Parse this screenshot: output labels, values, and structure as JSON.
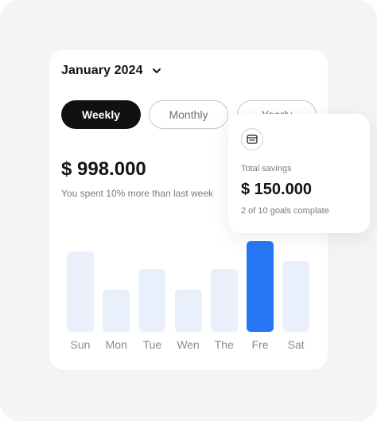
{
  "header": {
    "month_label": "January 2024",
    "dropdown_icon": "chevron-down-icon"
  },
  "tabs": [
    {
      "label": "Weekly",
      "active": true
    },
    {
      "label": "Monthly",
      "active": false
    },
    {
      "label": "Yearly",
      "active": false
    }
  ],
  "summary": {
    "amount": "$ 998.000",
    "subtitle": "You spent 10% more than last week"
  },
  "chart_data": {
    "type": "bar",
    "categories": [
      "Sun",
      "Mon",
      "Tue",
      "Wen",
      "The",
      "Fre",
      "Sat"
    ],
    "values": [
      100,
      53,
      78,
      53,
      78,
      113,
      88
    ],
    "highlight_index": 5,
    "colors": {
      "bar": "#e9f0fc",
      "active": "#2676f5"
    }
  },
  "savings_card": {
    "icon": "wallet-icon",
    "label": "Total savings",
    "amount": "$ 150.000",
    "goals": "2 of 10 goals complate"
  }
}
